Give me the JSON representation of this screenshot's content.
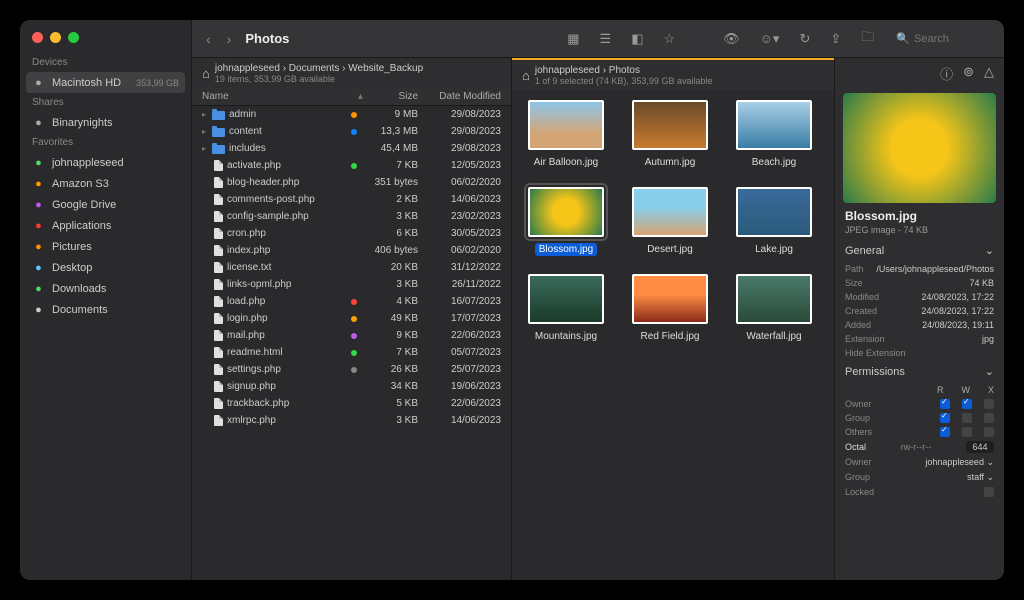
{
  "title": "Photos",
  "search_placeholder": "Search",
  "sidebar": {
    "sec_devices": "Devices",
    "sec_shares": "Shares",
    "sec_favorites": "Favorites",
    "devices": [
      {
        "label": "Macintosh HD",
        "badge": "353,99 GB"
      }
    ],
    "shares": [
      {
        "label": "Binarynights"
      }
    ],
    "favorites": [
      {
        "label": "johnappleseed",
        "color": "#4cd964"
      },
      {
        "label": "Amazon S3",
        "color": "#ff9500"
      },
      {
        "label": "Google Drive",
        "color": "#bf5af2"
      },
      {
        "label": "Applications",
        "color": "#ff3b30"
      },
      {
        "label": "Pictures",
        "color": "#ff9500"
      },
      {
        "label": "Desktop",
        "color": "#5ac8fa"
      },
      {
        "label": "Downloads",
        "color": "#4cd964"
      },
      {
        "label": "Documents",
        "color": "#ccc"
      }
    ]
  },
  "left": {
    "crumbs": [
      "johnappleseed",
      "Documents",
      "Website_Backup"
    ],
    "meta": "19 items, 353,99 GB available",
    "head": {
      "name": "Name",
      "size": "Size",
      "date": "Date Modified"
    },
    "rows": [
      {
        "name": "admin",
        "kind": "folder",
        "size": "9 MB",
        "date": "29/08/2023",
        "tag": "#ff9500"
      },
      {
        "name": "content",
        "kind": "folder",
        "size": "13,3 MB",
        "date": "29/08/2023",
        "tag": "#0a84ff"
      },
      {
        "name": "includes",
        "kind": "folder",
        "size": "45,4 MB",
        "date": "29/08/2023"
      },
      {
        "name": "activate.php",
        "kind": "file",
        "size": "7 KB",
        "date": "12/05/2023",
        "tag": "#32d74b"
      },
      {
        "name": "blog-header.php",
        "kind": "file",
        "size": "351 bytes",
        "date": "06/02/2020"
      },
      {
        "name": "comments-post.php",
        "kind": "file",
        "size": "2 KB",
        "date": "14/06/2023"
      },
      {
        "name": "config-sample.php",
        "kind": "file",
        "size": "3 KB",
        "date": "23/02/2023"
      },
      {
        "name": "cron.php",
        "kind": "file",
        "size": "6 KB",
        "date": "30/05/2023"
      },
      {
        "name": "index.php",
        "kind": "file",
        "size": "406 bytes",
        "date": "06/02/2020"
      },
      {
        "name": "license.txt",
        "kind": "file",
        "size": "20 KB",
        "date": "31/12/2022"
      },
      {
        "name": "links-opml.php",
        "kind": "file",
        "size": "3 KB",
        "date": "26/11/2022"
      },
      {
        "name": "load.php",
        "kind": "file",
        "size": "4 KB",
        "date": "16/07/2023",
        "tag": "#ff453a"
      },
      {
        "name": "login.php",
        "kind": "file",
        "size": "49 KB",
        "date": "17/07/2023",
        "tag": "#ff9f0a"
      },
      {
        "name": "mail.php",
        "kind": "file",
        "size": "9 KB",
        "date": "22/06/2023",
        "tag": "#bf5af2"
      },
      {
        "name": "readme.html",
        "kind": "file",
        "size": "7 KB",
        "date": "05/07/2023",
        "tag": "#32d74b"
      },
      {
        "name": "settings.php",
        "kind": "file",
        "size": "26 KB",
        "date": "25/07/2023",
        "tag": "#888"
      },
      {
        "name": "signup.php",
        "kind": "file",
        "size": "34 KB",
        "date": "19/06/2023"
      },
      {
        "name": "trackback.php",
        "kind": "file",
        "size": "5 KB",
        "date": "22/06/2023"
      },
      {
        "name": "xmlrpc.php",
        "kind": "file",
        "size": "3 KB",
        "date": "14/06/2023"
      }
    ]
  },
  "right": {
    "crumbs": [
      "johnappleseed",
      "Photos"
    ],
    "meta": "1 of 9 selected (74 KB), 353,99 GB available",
    "items": [
      {
        "label": "Air Balloon.jpg",
        "bg": "linear-gradient(#8ec5e8,#d4a574 70%)"
      },
      {
        "label": "Autumn.jpg",
        "bg": "linear-gradient(#6b4a2a,#c97b2e)"
      },
      {
        "label": "Beach.jpg",
        "bg": "linear-gradient(#a8d0e6,#3a7ca5)"
      },
      {
        "label": "Blossom.jpg",
        "bg": "radial-gradient(circle,#f5c518 30%,#2a7a4a)",
        "sel": true
      },
      {
        "label": "Desert.jpg",
        "bg": "linear-gradient(#87ceeb 40%,#d4a574)"
      },
      {
        "label": "Lake.jpg",
        "bg": "linear-gradient(#3a6a9a,#2a5a7a)"
      },
      {
        "label": "Mountains.jpg",
        "bg": "linear-gradient(#3a6a5a,#1a3a2a)"
      },
      {
        "label": "Red Field.jpg",
        "bg": "linear-gradient(#ff8c42 40%,#8b2a1a)"
      },
      {
        "label": "Waterfall.jpg",
        "bg": "linear-gradient(#4a7a6a,#2a4a3a)"
      }
    ]
  },
  "inspector": {
    "title": "Blossom.jpg",
    "sub": "JPEG image - 74 KB",
    "sec_general": "General",
    "sec_permissions": "Permissions",
    "general": [
      {
        "k": "Path",
        "v": "/Users/johnappleseed/Photos"
      },
      {
        "k": "Size",
        "v": "74 KB"
      },
      {
        "k": "Modified",
        "v": "24/08/2023, 17:22"
      },
      {
        "k": "Created",
        "v": "24/08/2023, 17:22"
      },
      {
        "k": "Added",
        "v": "24/08/2023, 19:11"
      },
      {
        "k": "Extension",
        "v": "jpg"
      },
      {
        "k": "Hide Extension",
        "v": ""
      }
    ],
    "perm_cols": [
      "R",
      "W",
      "X"
    ],
    "perm_rows": [
      {
        "k": "Owner",
        "r": true,
        "w": true,
        "x": false
      },
      {
        "k": "Group",
        "r": true,
        "w": false,
        "x": false
      },
      {
        "k": "Others",
        "r": true,
        "w": false,
        "x": false
      }
    ],
    "octal_label": "Octal",
    "octal_sym": "rw-r--r--",
    "octal": "644",
    "owner_label": "Owner",
    "owner": "johnappleseed",
    "group_label": "Group",
    "group": "staff",
    "locked_label": "Locked"
  }
}
